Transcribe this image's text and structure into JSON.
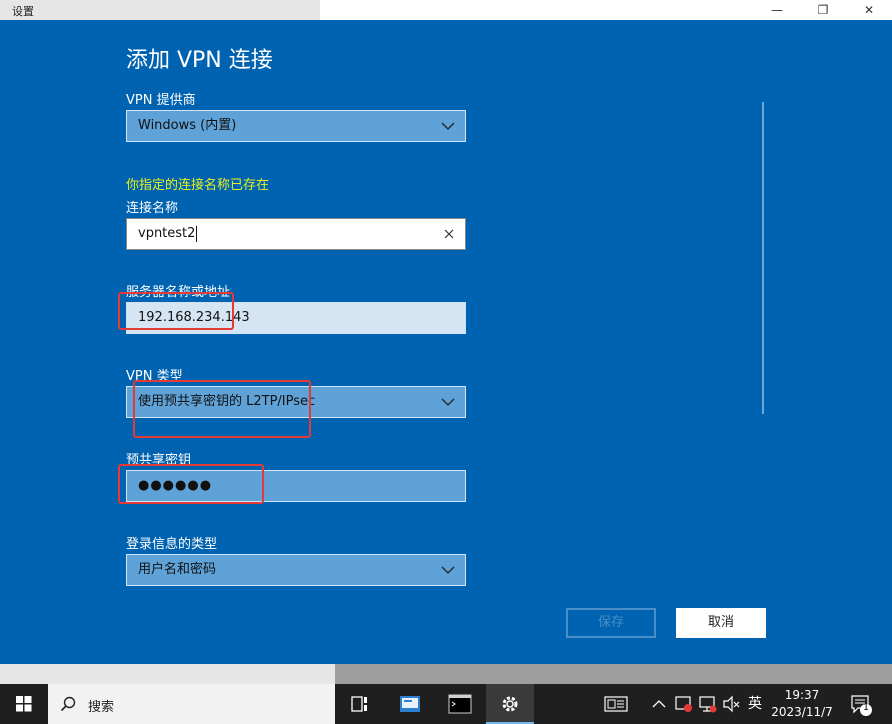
{
  "background_window": {
    "title": "设置",
    "controls": {
      "minimize": "—",
      "maximize": "❐",
      "close": "✕"
    }
  },
  "dialog": {
    "title": "添加 VPN 连接",
    "provider": {
      "label": "VPN 提供商",
      "value": "Windows (内置)"
    },
    "warning": "你指定的连接名称已存在",
    "connection_name": {
      "label": "连接名称",
      "value": "vpntest2"
    },
    "server": {
      "label": "服务器名称或地址",
      "value": "192.168.234.143"
    },
    "vpn_type": {
      "label": "VPN 类型",
      "value": "使用预共享密钥的 L2TP/IPsec"
    },
    "psk": {
      "label": "预共享密钥",
      "value": "●●●●●●"
    },
    "signin_type": {
      "label": "登录信息的类型",
      "value": "用户名和密码"
    },
    "buttons": {
      "save": "保存",
      "cancel": "取消"
    }
  },
  "taskbar": {
    "search_placeholder": "搜索",
    "tray": {
      "input_method": "英",
      "notification_count": "1"
    },
    "clock": {
      "time": "19:37",
      "date": "2023/11/7"
    }
  },
  "colors": {
    "dialog_bg": "#0063b1",
    "warning": "#e8f21c",
    "annotation": "#e53935",
    "taskbar": "#1f1f1f"
  }
}
